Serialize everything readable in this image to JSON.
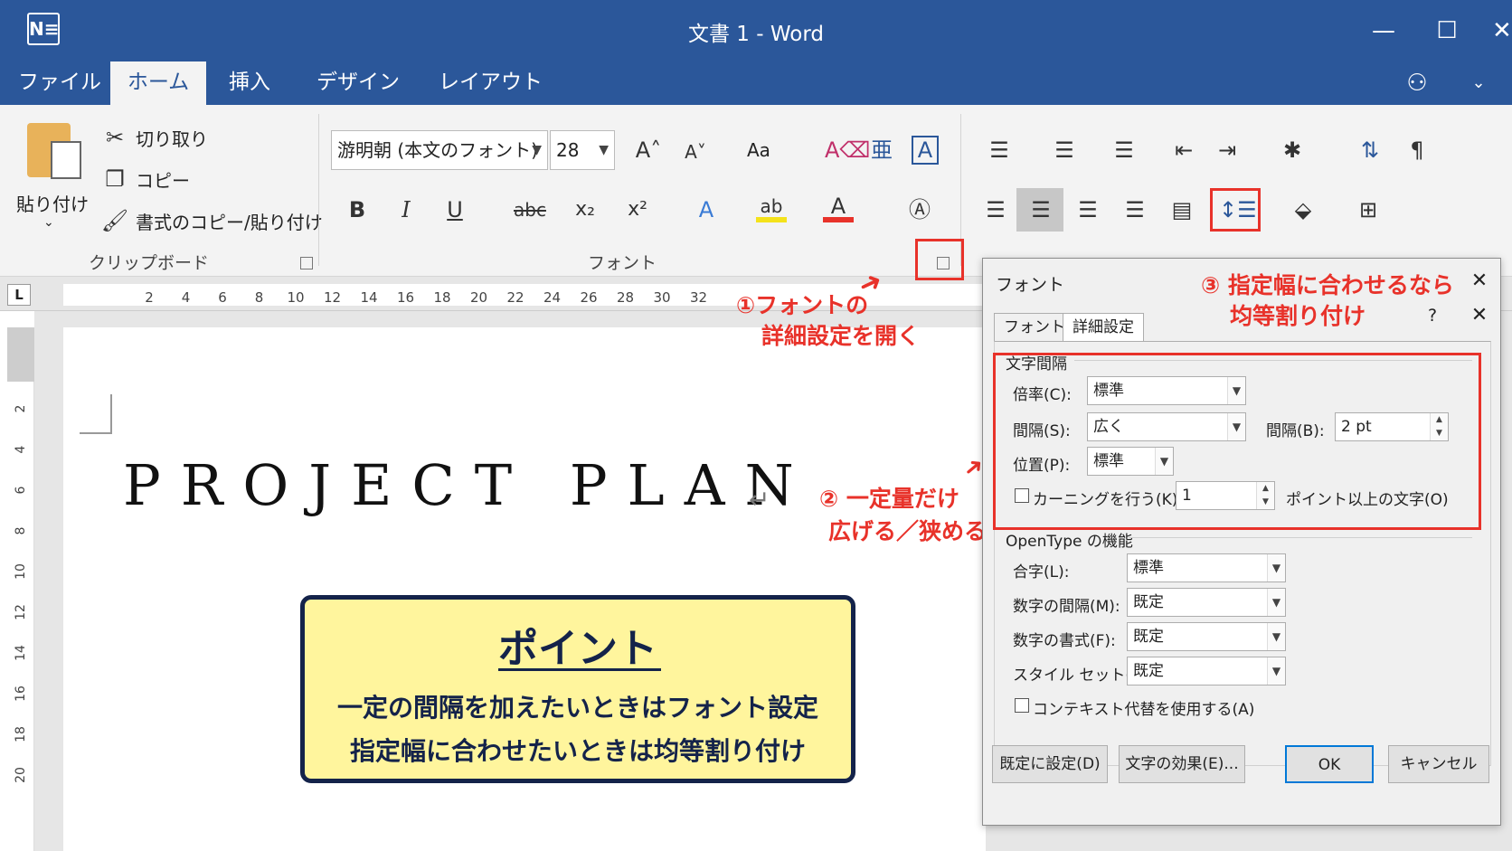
{
  "window": {
    "title": "文書 1 - Word",
    "app_icon": "N≡"
  },
  "tabs": [
    "ファイル",
    "ホーム",
    "挿入",
    "デザイン",
    "レイアウト"
  ],
  "clipboard": {
    "paste": "貼り付け",
    "cut": "切り取り",
    "copy": "コピー",
    "format_painter": "書式のコピー/貼り付け",
    "group": "クリップボード"
  },
  "font_group": {
    "font_name": "游明朝 (本文のフォント)",
    "font_size": "28",
    "group": "フォント",
    "change_case": "Aa"
  },
  "ruler": {
    "corner": "L",
    "ticks": [
      "2",
      "4",
      "6",
      "8",
      "10",
      "12",
      "14",
      "16",
      "18",
      "20",
      "22",
      "24",
      "26",
      "28",
      "30",
      "32"
    ],
    "vticks": [
      "2",
      "4",
      "6",
      "8",
      "10",
      "12",
      "14",
      "16",
      "18",
      "20"
    ]
  },
  "document": {
    "heading": "PROJECT PLAN",
    "para_mark": "↵"
  },
  "point_box": {
    "title": "ポイント",
    "line1": "一定の間隔を加えたいときはフォント設定",
    "line2": "指定幅に合わせたいときは均等割り付け"
  },
  "annotations": {
    "a1_line1": "①フォントの",
    "a1_line2": "詳細設定を開く",
    "a2_line1": "② 一定量だけ",
    "a2_line2": "広げる／狭める",
    "a3_line1": "③ 指定幅に合わせるなら",
    "a3_line2": "均等割り付け"
  },
  "colors": {
    "word_blue": "#2b579a",
    "annotation_red": "#e8322a",
    "point_yellow": "#fff59d",
    "point_navy": "#14234a"
  },
  "dialog": {
    "title": "フォント",
    "help": "?",
    "tabs": [
      "フォント",
      "詳細設定"
    ],
    "spacing_section": "文字間隔",
    "scale_label": "倍率(C):",
    "scale_value": "標準",
    "spacing_label": "間隔(S):",
    "spacing_value": "広く",
    "by_label": "間隔(B):",
    "by_value": "2 pt",
    "position_label": "位置(P):",
    "position_value": "標準",
    "kerning_label": "カーニングを行う(K):",
    "kerning_value": "1",
    "kerning_suffix": "ポイント以上の文字(O)",
    "opentype_section": "OpenType の機能",
    "ligatures_label": "合字(L):",
    "ligatures_value": "標準",
    "num_spacing_label": "数字の間隔(M):",
    "num_spacing_value": "既定",
    "num_forms_label": "数字の書式(F):",
    "num_forms_value": "既定",
    "stylistic_label": "スタイル セット(I):",
    "stylistic_value": "既定",
    "contextual_label": "コンテキスト代替を使用する(A)",
    "set_default": "既定に設定(D)",
    "text_effects": "文字の効果(E)...",
    "ok": "OK",
    "cancel": "キャンセル"
  }
}
